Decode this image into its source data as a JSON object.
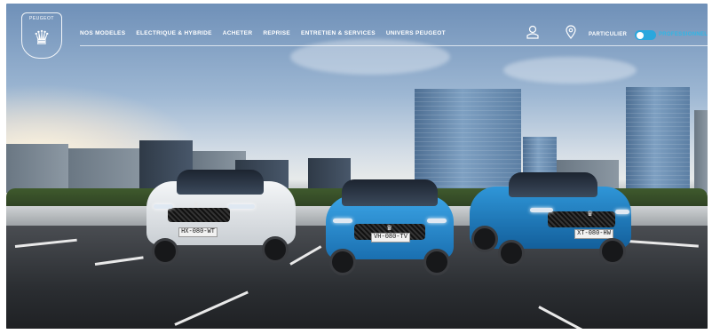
{
  "brand": {
    "logo_text": "PEUGEOT"
  },
  "nav": {
    "items": [
      "NOS MODELES",
      "ELECTRIQUE & HYBRIDE",
      "ACHETER",
      "REPRISE",
      "ENTRETIEN & SERVICES",
      "UNIVERS PEUGEOT"
    ]
  },
  "header": {
    "account_icon": "user-icon",
    "location_icon": "map-pin-icon",
    "segment_left": "PARTICULIER",
    "segment_right": "PROFESSIONNEL"
  },
  "hero": {
    "cars": [
      {
        "model": "SUV white",
        "plate": "HX-080-WT",
        "badge": "PEUGEOT"
      },
      {
        "model": "hatchback blue",
        "plate": "VH-080-TV",
        "badge": "PEUGEOT"
      },
      {
        "model": "crossover blue",
        "plate": "XT-080-HW",
        "badge": "PEUGEOT"
      }
    ]
  },
  "colors": {
    "accent": "#2aa7dd",
    "car_blue": "#1f87c9",
    "car_white": "#e9ecef"
  }
}
